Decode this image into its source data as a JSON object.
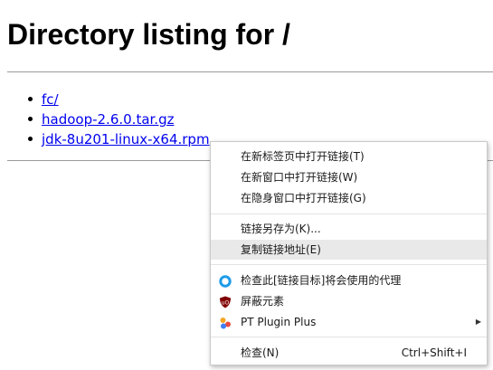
{
  "page": {
    "title": "Directory listing for /"
  },
  "files": [
    {
      "name": "fc/"
    },
    {
      "name": "hadoop-2.6.0.tar.gz"
    },
    {
      "name": "jdk-8u201-linux-x64.rpm"
    }
  ],
  "context_menu": {
    "open_new_tab": "在新标签页中打开链接(T)",
    "open_new_window": "在新窗口中打开链接(W)",
    "open_incognito": "在隐身窗口中打开链接(G)",
    "save_link_as": "链接另存为(K)...",
    "copy_link_address": "复制链接地址(E)",
    "check_link_target_proxy": "检查此[链接目标]将会使用的代理",
    "block_element": "屏蔽元素",
    "pt_plugin_plus": "PT Plugin Plus",
    "inspect": "检查(N)",
    "inspect_shortcut": "Ctrl+Shift+I"
  },
  "icons": {
    "proxy_icon": "blue-ring-icon",
    "block_icon": "ublock-shield-icon",
    "pt_plugin_icon": "pt-plugin-dots-icon",
    "submenu": "chevron-right-icon"
  },
  "colors": {
    "link": "#0000ee",
    "menu_highlight": "#e9e9ea",
    "proxy_icon": "#1e9be9",
    "ublock_icon": "#800000"
  }
}
